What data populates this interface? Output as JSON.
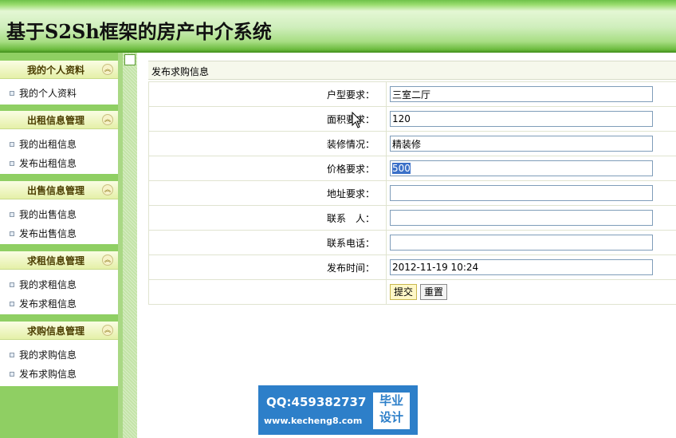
{
  "app": {
    "title": "基于S2Sh框架的房产中介系统"
  },
  "sidebar": {
    "groups": [
      {
        "title": "我的个人资料",
        "items": [
          "我的个人资料"
        ]
      },
      {
        "title": "出租信息管理",
        "items": [
          "我的出租信息",
          "发布出租信息"
        ]
      },
      {
        "title": "出售信息管理",
        "items": [
          "我的出售信息",
          "发布出售信息"
        ]
      },
      {
        "title": "求租信息管理",
        "items": [
          "我的求租信息",
          "发布求租信息"
        ]
      },
      {
        "title": "求购信息管理",
        "items": [
          "我的求购信息",
          "发布求购信息"
        ]
      }
    ]
  },
  "form": {
    "title": "发布求购信息",
    "fields": [
      {
        "label": "户型要求：",
        "value": "三室二厅"
      },
      {
        "label": "面积要求：",
        "value": "120"
      },
      {
        "label": "装修情况：",
        "value": "精装修"
      },
      {
        "label": "价格要求：",
        "value": "500"
      },
      {
        "label": "地址要求：",
        "value": ""
      },
      {
        "label": "联系　人：",
        "value": ""
      },
      {
        "label": "联系电话：",
        "value": ""
      },
      {
        "label": "发布时间：",
        "value": "2012-11-19 10:24"
      }
    ],
    "submit_label": "提交",
    "reset_label": "重置"
  },
  "watermark": {
    "qq": "QQ:459382737",
    "url": "www.kecheng8.com",
    "badge_line1": "毕业",
    "badge_line2": "设计",
    "color": "#2d7fc9"
  },
  "colors": {
    "header_green": "#6cbb3e",
    "sidebar_green": "#8fcf63",
    "selection": "#3a70c8"
  }
}
